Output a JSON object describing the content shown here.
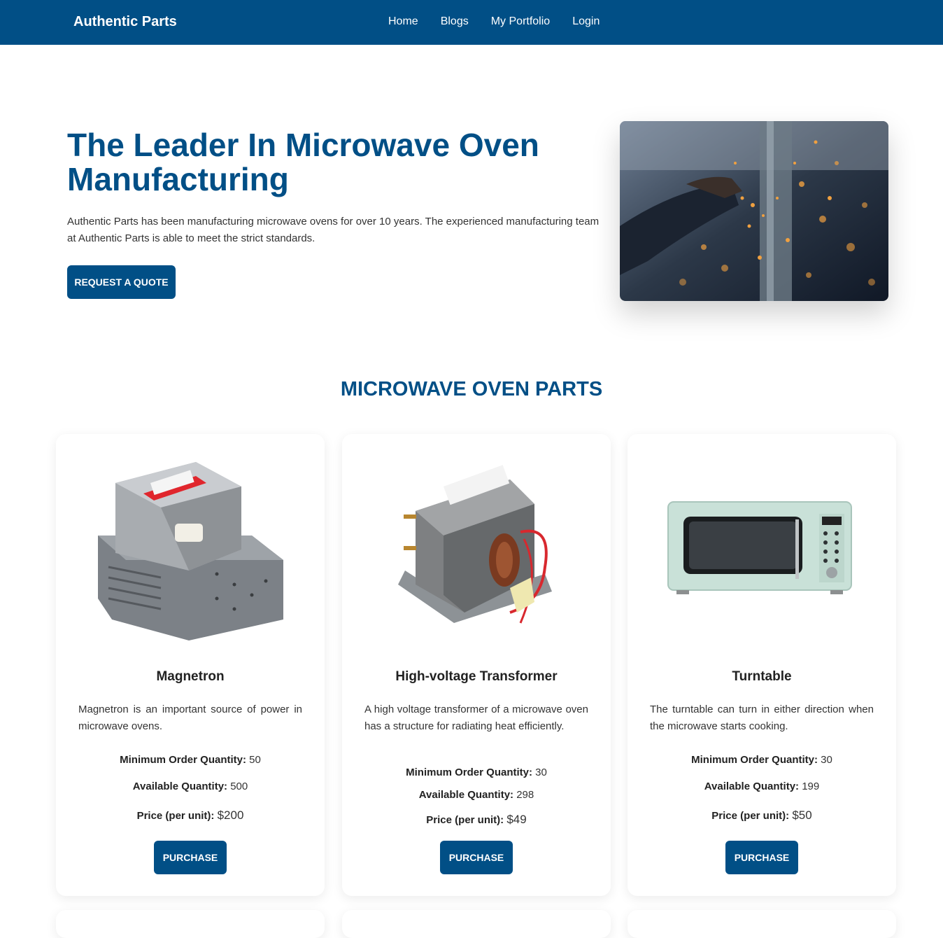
{
  "nav": {
    "brand": "Authentic Parts",
    "links": [
      "Home",
      "Blogs",
      "My Portfolio",
      "Login"
    ]
  },
  "hero": {
    "title": "The Leader In Microwave Oven Manufacturing",
    "description": "Authentic Parts has been manufacturing microwave ovens for over 10 years. The experienced manufacturing team at Authentic Parts is able to meet the strict standards.",
    "cta": "REQUEST A QUOTE"
  },
  "parts_section": {
    "title": "MICROWAVE OVEN PARTS",
    "labels": {
      "min_order": "Minimum Order Quantity:",
      "available": "Available Quantity:",
      "price": "Price (per unit):",
      "purchase": "PURCHASE"
    },
    "cards": [
      {
        "name": "Magnetron",
        "description": "Magnetron is an important source of power in microwave ovens.",
        "min_order": "50",
        "available": "500",
        "price": "$200"
      },
      {
        "name": "High-voltage Transformer",
        "description": "A high voltage transformer of a microwave oven has a structure for radiating heat efficiently.",
        "min_order": "30",
        "available": "298",
        "price": "$49"
      },
      {
        "name": "Turntable",
        "description": "The turntable can turn in either direction when the microwave starts cooking.",
        "min_order": "30",
        "available": "199",
        "price": "$50"
      }
    ]
  },
  "colors": {
    "primary": "#014f86",
    "text": "#333333"
  }
}
